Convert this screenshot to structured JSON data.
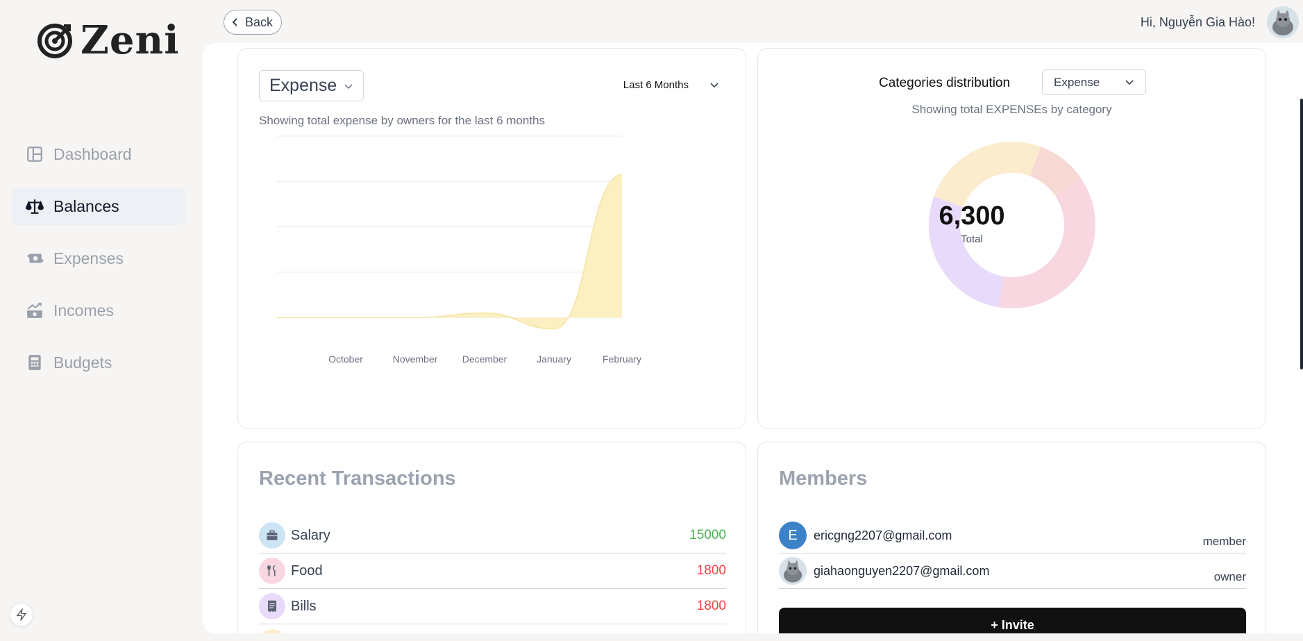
{
  "app": {
    "name": "Zeni"
  },
  "sidebar": {
    "items": [
      {
        "label": "Dashboard",
        "icon": "layout-icon",
        "active": false
      },
      {
        "label": "Balances",
        "icon": "scale-icon",
        "active": true
      },
      {
        "label": "Expenses",
        "icon": "money-icon",
        "active": false
      },
      {
        "label": "Incomes",
        "icon": "growth-icon",
        "active": false
      },
      {
        "label": "Budgets",
        "icon": "calculator-icon",
        "active": false
      }
    ]
  },
  "header": {
    "back_label": "Back",
    "greeting": "Hi, Nguyễn Gia Hào!"
  },
  "owners_card": {
    "type_select": "Expense",
    "period_select": "Last 6 Months",
    "subtitle": "Showing total expense by owners for the last 6 months"
  },
  "chart_data": {
    "type": "area",
    "categories": [
      "October",
      "November",
      "December",
      "January",
      "February"
    ],
    "series": [
      {
        "values": [
          0,
          0,
          100,
          -250,
          3150
        ]
      }
    ],
    "ylim": [
      -500,
      4000
    ],
    "grid": true,
    "color": "#fcefc0"
  },
  "categories_card": {
    "title": "Categories distribution",
    "type_select": "Expense",
    "subtitle": "Showing total EXPENSEs by category",
    "total": "6,300",
    "total_label": "Total",
    "segments": [
      {
        "value": 0.1,
        "color": "#f7d9d3"
      },
      {
        "value": 0.37,
        "color": "#f8d7e1"
      },
      {
        "value": 0.28,
        "color": "#e8dafa"
      },
      {
        "value": 0.25,
        "color": "#fcecce"
      }
    ]
  },
  "transactions": {
    "title": "Recent Transactions",
    "items": [
      {
        "name": "Salary",
        "amount": "15000",
        "kind": "income",
        "icon": "briefcase-icon",
        "bg": "#cde4f5"
      },
      {
        "name": "Food",
        "amount": "1800",
        "kind": "expense",
        "icon": "utensils-icon",
        "bg": "#f8d7e1"
      },
      {
        "name": "Bills",
        "amount": "1800",
        "kind": "expense",
        "icon": "receipt-icon",
        "bg": "#e8dafa"
      }
    ]
  },
  "members": {
    "title": "Members",
    "items": [
      {
        "email": "ericgng2207@gmail.com",
        "role": "member",
        "initial": "E"
      },
      {
        "email": "giahaonguyen2207@gmail.com",
        "role": "owner",
        "initial": ""
      }
    ],
    "invite_label": "+ Invite"
  }
}
